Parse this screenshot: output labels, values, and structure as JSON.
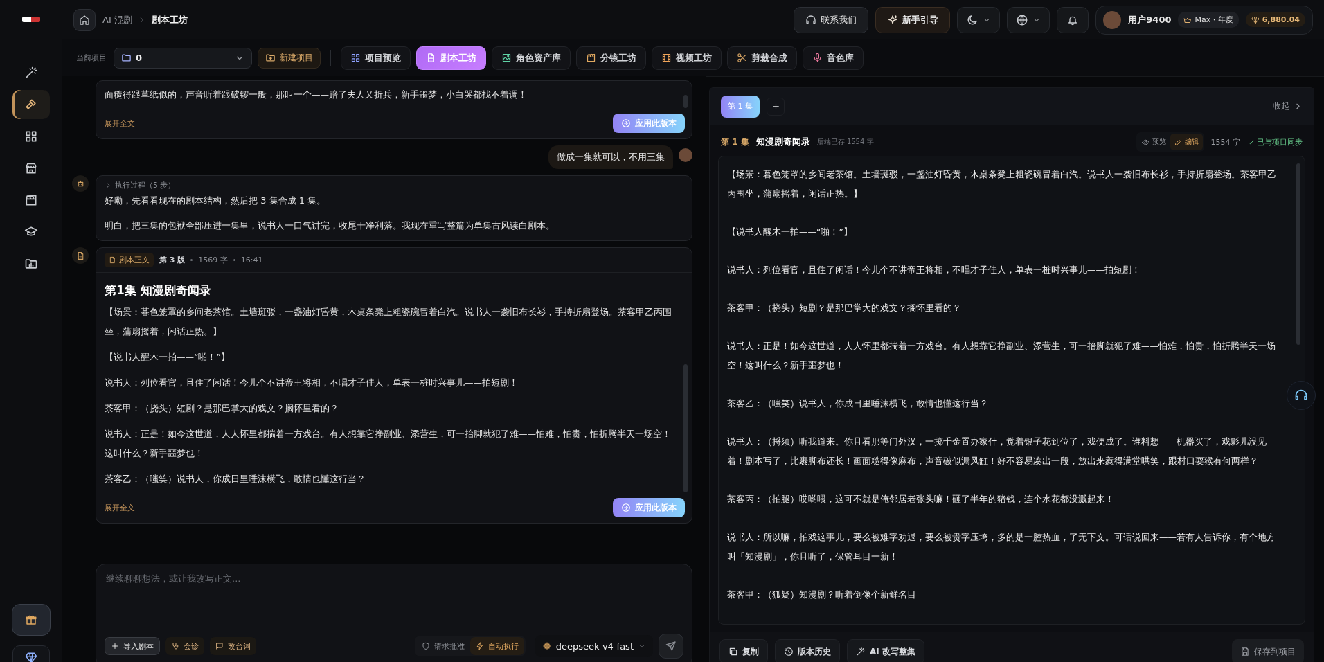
{
  "sidebar": {
    "items": [
      {
        "selected": false
      },
      {
        "selected": true
      },
      {
        "selected": false
      },
      {
        "selected": false
      },
      {
        "selected": false
      },
      {
        "selected": false
      },
      {
        "selected": false
      }
    ]
  },
  "header": {
    "breadcrumb": [
      "AI 混剧",
      "剧本工坊"
    ],
    "actions": [
      "联系我们",
      "新手引导"
    ],
    "user": {
      "name": "用户9400",
      "plan": "Max · 年度",
      "balance": "6,880.04"
    }
  },
  "toolbar": {
    "project_label": "当前项目",
    "project_value": "0",
    "new_project": "新建项目",
    "tabs": [
      {
        "label": "项目预览",
        "selected": false
      },
      {
        "label": "剧本工坊",
        "selected": true
      },
      {
        "label": "角色资产库",
        "selected": false
      },
      {
        "label": "分镜工坊",
        "selected": false
      },
      {
        "label": "视频工坊",
        "selected": false
      },
      {
        "label": "剪裁合成",
        "selected": false
      },
      {
        "label": "音色库",
        "selected": false
      }
    ]
  },
  "chat": {
    "messages": [
      {
        "kind": "script_tail",
        "paragraphs": [
          "面糙得跟草纸似的，声音听着跟破锣一般，那叫一个——赔了夫人又折兵，新手噩梦，小白哭都找不着调！"
        ],
        "expand": "展开全文",
        "apply": "应用此版本"
      },
      {
        "kind": "user",
        "text": "做成一集就可以，不用三集"
      },
      {
        "kind": "assistant",
        "steps": "执行过程（5 步）",
        "paragraphs": [
          "好嘞，先看看现在的剧本结构，然后把 3 集合成 1 集。",
          "明白，把三集的包袱全部压进一集里，说书人一口气讲完，收尾干净利落。我现在重写整篇为单集古风读白剧本。"
        ]
      },
      {
        "kind": "script",
        "tag": "剧本正文",
        "version": "第 3 版",
        "count": "1569 字",
        "time": "16:41",
        "title": "第1集 知漫剧奇闻录",
        "paragraphs": [
          "【场景：暮色笼罩的乡间老茶馆。土墙斑驳，一盏油灯昏黄，木桌条凳上粗瓷碗冒着白汽。说书人一袭旧布长衫，手持折扇登场。茶客甲乙丙围坐，蒲扇摇着，闲话正热。】",
          "【说书人醒木一拍——“啪！”】",
          "说书人：列位看官，且住了闲话！今儿个不讲帝王将相，不唱才子佳人，单表一桩时兴事儿——拍短剧！",
          "茶客甲：（挠头）短剧？是那巴掌大的戏文？搁怀里看的？",
          "说书人：正是！如今这世道，人人怀里都揣着一方戏台。有人想靠它挣副业、添营生，可一抬脚就犯了难——怕难，怕贵，怕折腾半天一场空！这叫什么？新手噩梦也！",
          "茶客乙：（嗤笑）说书人，你成日里唾沫横飞，敢情也懂这行当？"
        ],
        "expand": "展开全文",
        "apply": "应用此版本"
      }
    ],
    "composer": {
      "placeholder": "继续聊聊想法，或让我改写正文...",
      "buttons": [
        "导入剧本",
        "会诊",
        "改台词"
      ],
      "modes": [
        {
          "label": "请求批准",
          "selected": false
        },
        {
          "label": "自动执行",
          "selected": true
        }
      ],
      "model": "deepseek-v4-fast"
    }
  },
  "editor": {
    "episodes": [
      {
        "label": "第 1 集",
        "selected": true
      }
    ],
    "collapse": "收起",
    "episode_no": "第 1 集",
    "title": "知漫剧奇闻录",
    "saved": "后端已存 1554 字",
    "views": [
      {
        "label": "预览",
        "selected": false
      },
      {
        "label": "编辑",
        "selected": true
      }
    ],
    "count": "1554 字",
    "sync": "已与项目同步",
    "paragraphs": [
      "【场景：暮色笼罩的乡间老茶馆。土墙斑驳，一盏油灯昏黄，木桌条凳上粗瓷碗冒着白汽。说书人一袭旧布长衫，手持折扇登场。茶客甲乙丙围坐，蒲扇摇着，闲话正热。】",
      "【说书人醒木一拍——“啪！”】",
      "说书人：列位看官，且住了闲话！今儿个不讲帝王将相，不唱才子佳人，单表一桩时兴事儿——拍短剧！",
      "茶客甲：（挠头）短剧？是那巴掌大的戏文？搁怀里看的？",
      "说书人：正是！如今这世道，人人怀里都揣着一方戏台。有人想靠它挣副业、添营生，可一抬脚就犯了难——怕难，怕贵，怕折腾半天一场空！这叫什么？新手噩梦也！",
      "茶客乙：（嗤笑）说书人，你成日里唾沫横飞，敢情也懂这行当？",
      "说书人：（捋须）听我道来。你且看那等门外汉，一掷千金置办家什，觉着银子花到位了，戏便成了。谁料想——机器买了，戏影儿没见着！剧本写了，比裹脚布还长！画面糙得像麻布，声音破似漏风缸！好不容易凑出一段，放出来惹得满堂哄笑，跟村口耍猴有何两样？",
      "茶客丙：（拍腿）哎哟喂，这可不就是俺邻居老张头嘛！砸了半年的猪钱，连个水花都没溅起来！",
      "说书人：所以嘛，拍戏这事儿，要么被难字劝退，要么被贵字压垮，多的是一腔热血，了无下文。可话说回来——若有人告诉你，有个地方叫「知漫剧」，你且听了，保管耳目一新！",
      "茶客甲：（狐疑）知漫剧？听着倒像个新鲜名目"
    ],
    "actions": [
      "复制",
      "版本历史",
      "AI 改写整集"
    ],
    "save": "保存到项目"
  }
}
